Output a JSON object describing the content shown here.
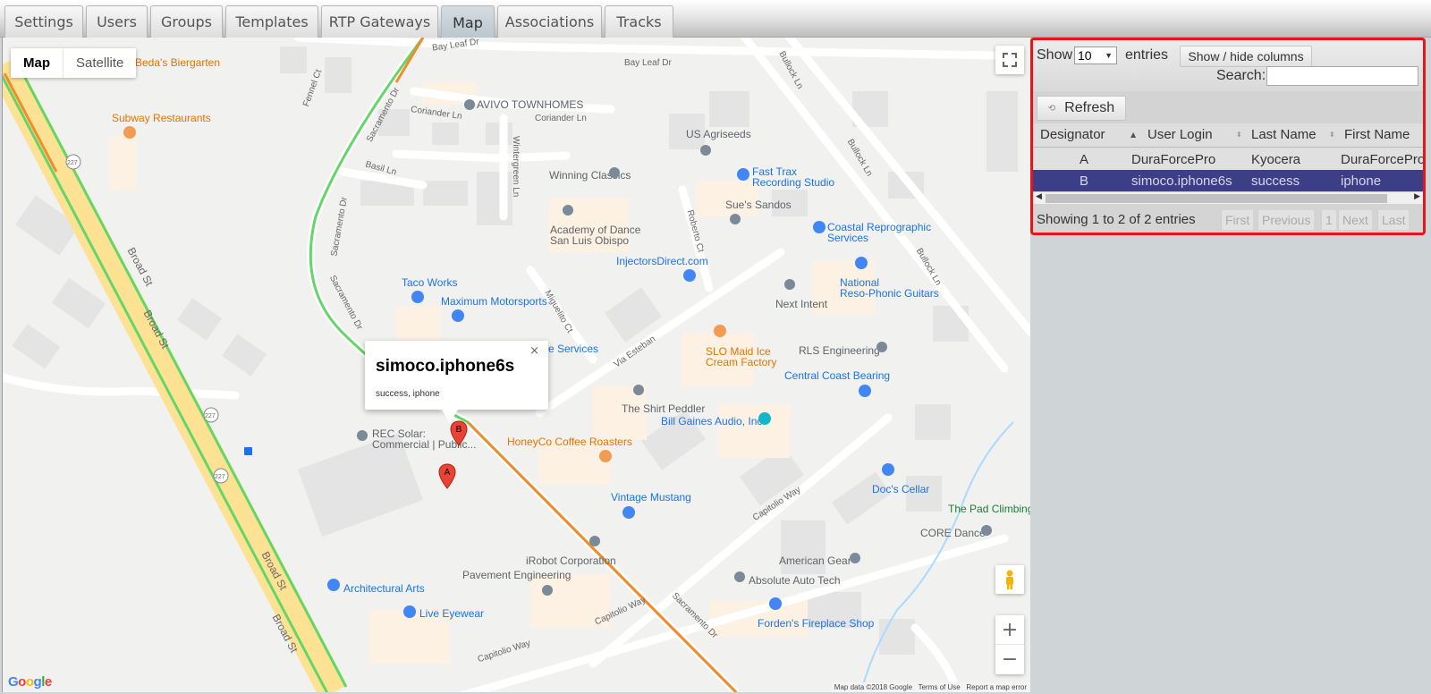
{
  "tabs": [
    "Settings",
    "Users",
    "Groups",
    "Templates",
    "RTP Gateways",
    "Map",
    "Associations",
    "Tracks"
  ],
  "active_tab": "Map",
  "map": {
    "type_map": "Map",
    "type_satellite": "Satellite",
    "zoom_in": "+",
    "zoom_out": "−",
    "google_logo": "Google",
    "attribution_data": "Map data ©2018 Google",
    "attribution_terms": "Terms of Use",
    "attribution_report": "Report a map error",
    "infowindow": {
      "title": "simoco.iphone6s",
      "subtitle": "success, iphone",
      "close": "×"
    },
    "markers": [
      "A",
      "B"
    ],
    "places": {
      "bedas": "Beda's Biergarten",
      "subway": "Subway Restaurants",
      "avivo": "AVIVO TOWNHOMES",
      "us_agriseeds": "US Agriseeds",
      "winning": "Winning Classics",
      "fast_trax_1": "Fast Trax",
      "fast_trax_2": "Recording Studio",
      "sues": "Sue's Sandos",
      "academy_1": "Academy of Dance",
      "academy_2": "San Luis Obispo",
      "coastal_1": "Coastal Reprographic",
      "coastal_2": "Services",
      "injectors": "InjectorsDirect.com",
      "national_1": "National",
      "national_2": "Reso-Phonic Guitars",
      "taco": "Taco Works",
      "maximum": "Maximum Motorsports",
      "next_intent": "Next Intent",
      "services": "e Services",
      "slo_1": "SLO Maid Ice",
      "slo_2": "Cream Factory",
      "rls": "RLS Engineering",
      "central": "Central Coast Bearing",
      "shirt": "The Shirt Peddler",
      "bill": "Bill Gaines Audio, Inc",
      "rec_1": "REC Solar:",
      "rec_2": "Commercial | Public...",
      "honeyco": "HoneyCo Coffee Roasters",
      "docs": "Doc's Cellar",
      "pad": "The Pad Climbing",
      "core": "CORE Dance",
      "vintage": "Vintage Mustang",
      "irobot": "iRobot Corporation",
      "pavement": "Pavement Engineering",
      "american": "American Gear",
      "absolute": "Absolute Auto Tech",
      "architectural": "Architectural Arts",
      "live": "Live Eyewear",
      "fordens": "Forden's Fireplace Shop"
    },
    "streets": {
      "bay_leaf_1": "Bay Leaf Dr",
      "bay_leaf_2": "Bay Leaf Dr",
      "fennel": "Fennel Ct",
      "sacramento": "Sacramento Dr",
      "coriander_1": "Coriander Ln",
      "coriander_2": "Coriander Ln",
      "wintergreen": "Wintergreen Ln",
      "basil": "Basil Ln",
      "bullock": "Bullock Ln",
      "broad": "Broad St",
      "roberto": "Roberto Ct",
      "miguelito": "Miguelito Ct",
      "via_esteban": "Via Esteban",
      "capitolio": "Capitolio Way",
      "hwy": "227"
    }
  },
  "panel": {
    "show_label": "Show",
    "entries_value": "10",
    "entries_label": "entries",
    "show_hide_columns": "Show / hide columns",
    "search_label": "Search:",
    "search_value": "",
    "refresh": "Refresh",
    "columns": [
      "Designator",
      "User Login",
      "Last Name",
      "First Name"
    ],
    "rows": [
      [
        "A",
        "DuraForcePro",
        "Kyocera",
        "DuraForcePro"
      ],
      [
        "B",
        "simoco.iphone6s",
        "success",
        "iphone"
      ]
    ],
    "selected_row": 1,
    "info": "Showing 1 to 2 of 2 entries",
    "pagination": [
      "First",
      "Previous",
      "1",
      "Next",
      "Last"
    ]
  }
}
